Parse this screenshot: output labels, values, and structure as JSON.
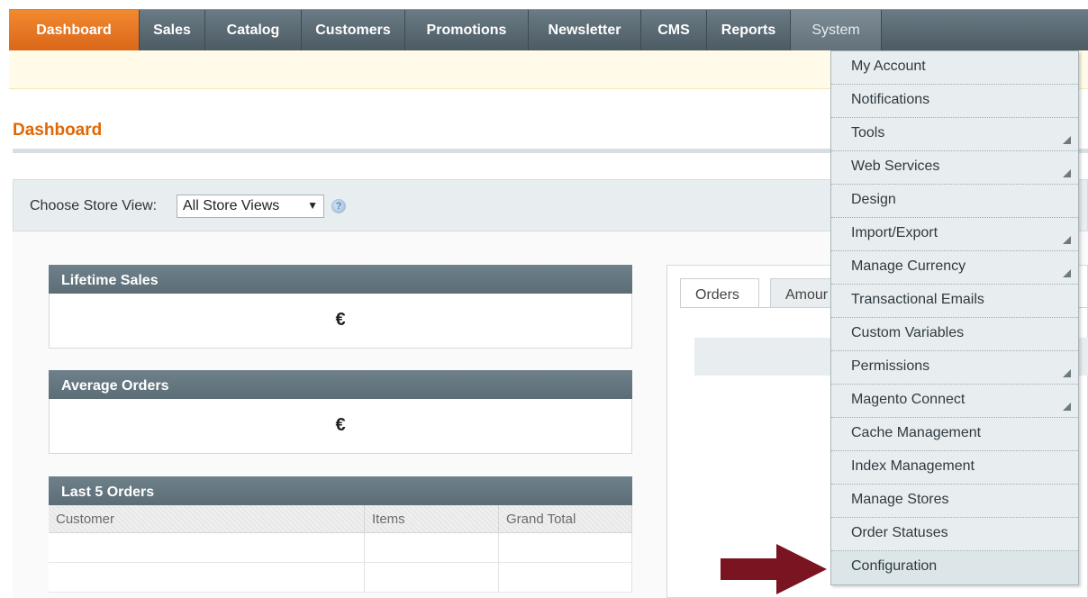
{
  "nav": {
    "items": [
      {
        "label": "Dashboard",
        "active": true
      },
      {
        "label": "Sales"
      },
      {
        "label": "Catalog"
      },
      {
        "label": "Customers"
      },
      {
        "label": "Promotions"
      },
      {
        "label": "Newsletter"
      },
      {
        "label": "CMS"
      },
      {
        "label": "Reports"
      },
      {
        "label": "System",
        "open": true
      }
    ]
  },
  "page": {
    "title": "Dashboard"
  },
  "store_switcher": {
    "label": "Choose Store View:",
    "selected": "All Store Views",
    "help_icon": "help-icon"
  },
  "lifetime_sales": {
    "title": "Lifetime Sales",
    "value": "€"
  },
  "average_orders": {
    "title": "Average Orders",
    "value": "€"
  },
  "last_orders": {
    "title": "Last 5 Orders",
    "columns": [
      "Customer",
      "Items",
      "Grand Total"
    ]
  },
  "tabs": {
    "orders": "Orders",
    "amounts": "Amour"
  },
  "system_menu": {
    "items": [
      {
        "label": "My Account",
        "submenu": false
      },
      {
        "label": "Notifications",
        "submenu": false
      },
      {
        "label": "Tools",
        "submenu": true
      },
      {
        "label": "Web Services",
        "submenu": true
      },
      {
        "label": "Design",
        "submenu": false
      },
      {
        "label": "Import/Export",
        "submenu": true
      },
      {
        "label": "Manage Currency",
        "submenu": true
      },
      {
        "label": "Transactional Emails",
        "submenu": false
      },
      {
        "label": "Custom Variables",
        "submenu": false
      },
      {
        "label": "Permissions",
        "submenu": true
      },
      {
        "label": "Magento Connect",
        "submenu": true
      },
      {
        "label": "Cache Management",
        "submenu": false
      },
      {
        "label": "Index Management",
        "submenu": false
      },
      {
        "label": "Manage Stores",
        "submenu": false
      },
      {
        "label": "Order Statuses",
        "submenu": false
      },
      {
        "label": "Configuration",
        "submenu": false,
        "highlighted": true
      }
    ]
  },
  "colors": {
    "active_tab": "#e26703",
    "nav_bg": "#5c6b74",
    "arrow": "#7a1420"
  }
}
